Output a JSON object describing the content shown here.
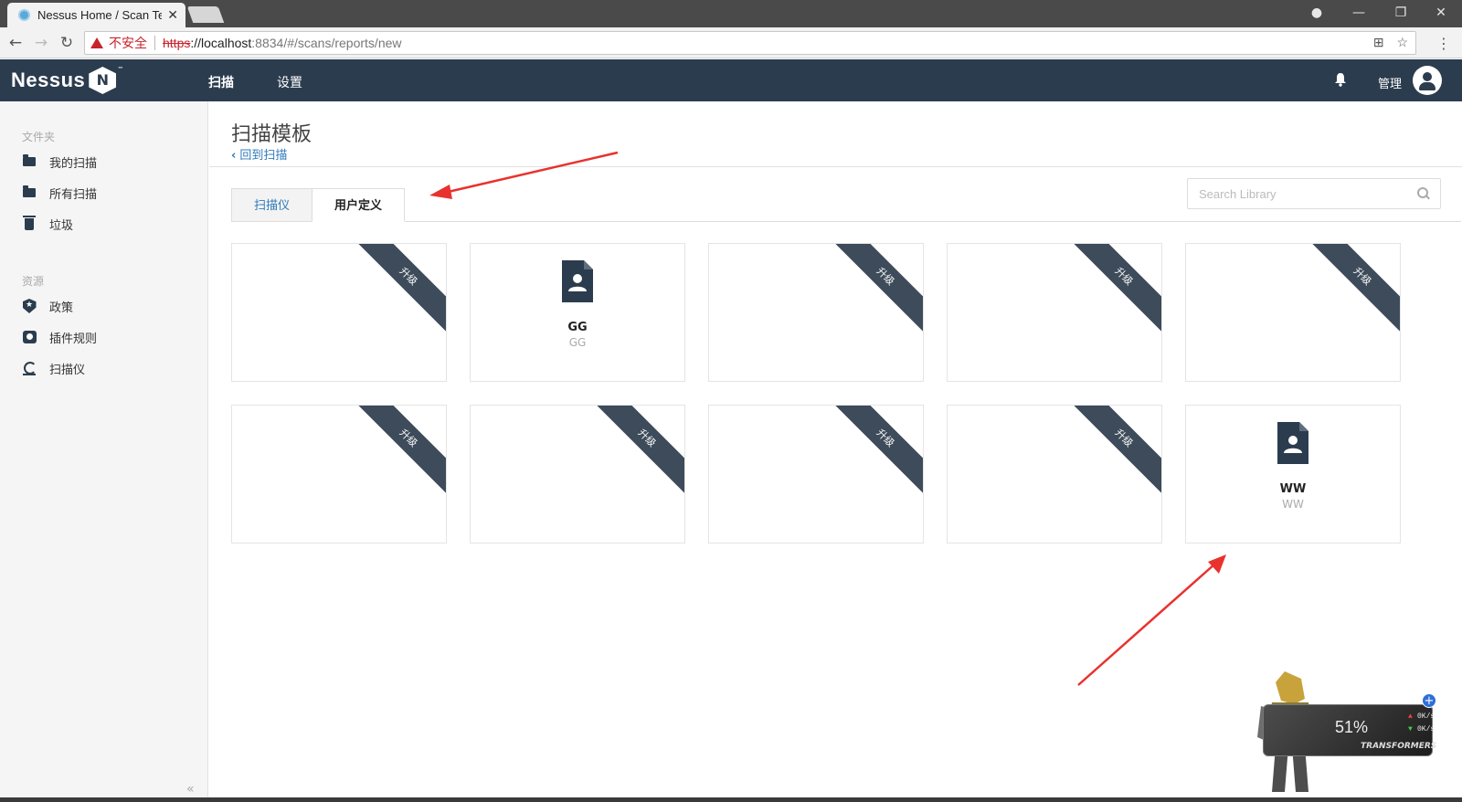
{
  "browser": {
    "tab_title": "Nessus Home / Scan Te",
    "tab_close": "✕",
    "insecure_label": "不安全",
    "url_scheme": "https",
    "url_host": "://localhost",
    "url_path": ":8834/#/scans/reports/new"
  },
  "app": {
    "logo_text": "Nessus",
    "logo_letter": "N",
    "logo_tm": "™",
    "nav": [
      {
        "label": "扫描"
      },
      {
        "label": "设置"
      }
    ],
    "admin_label": "管理"
  },
  "sidebar": {
    "section_folders": "文件夹",
    "folders": [
      {
        "label": "我的扫描",
        "icon": "folder-icon"
      },
      {
        "label": "所有扫描",
        "icon": "folder-icon"
      },
      {
        "label": "垃圾",
        "icon": "trash-icon"
      }
    ],
    "section_resources": "资源",
    "resources": [
      {
        "label": "政策",
        "icon": "shield-icon"
      },
      {
        "label": "插件规则",
        "icon": "plugin-icon"
      },
      {
        "label": "扫描仪",
        "icon": "scanner-icon"
      }
    ],
    "collapse": "«"
  },
  "main": {
    "title": "扫描模板",
    "back_link": "回到扫描",
    "tabs": [
      {
        "label": "扫描仪"
      },
      {
        "label": "用户定义"
      }
    ],
    "search_placeholder": "Search Library",
    "cards": [
      {
        "ribbon": "升级",
        "title": "",
        "subtitle": ""
      },
      {
        "ribbon": "",
        "title": "GG",
        "subtitle": "GG"
      },
      {
        "ribbon": "升级",
        "title": "",
        "subtitle": ""
      },
      {
        "ribbon": "升级",
        "title": "",
        "subtitle": ""
      },
      {
        "ribbon": "升级",
        "title": "",
        "subtitle": ""
      },
      {
        "ribbon": "升级",
        "title": "",
        "subtitle": ""
      },
      {
        "ribbon": "升级",
        "title": "",
        "subtitle": ""
      },
      {
        "ribbon": "升级",
        "title": "",
        "subtitle": ""
      },
      {
        "ribbon": "升级",
        "title": "",
        "subtitle": ""
      },
      {
        "ribbon": "",
        "title": "WW",
        "subtitle": "WW"
      }
    ]
  },
  "widget": {
    "percent": "51%",
    "upload": "0K/s",
    "download": "0K/s",
    "brand": "TRANSFORMERS",
    "plus": "+"
  },
  "colors": {
    "header_bg": "#2b3c4e",
    "ribbon_bg": "#3d4b5a",
    "link": "#2f7ab9",
    "annotation_arrow": "#e8322e"
  }
}
